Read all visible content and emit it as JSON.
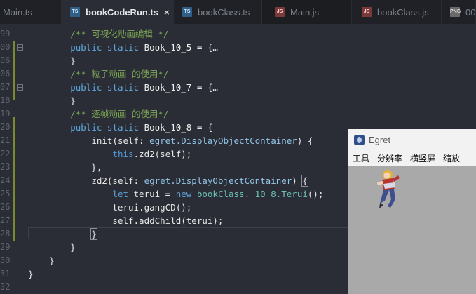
{
  "tabs": [
    {
      "label": "Main.ts",
      "icon": "ts-file-icon",
      "active": false
    },
    {
      "label": "bookCodeRun.ts",
      "icon": "ts-file-icon",
      "active": true,
      "close": "×"
    },
    {
      "label": "bookClass.ts",
      "icon": "ts-file-icon",
      "active": false
    },
    {
      "label": "Main.js",
      "icon": "js-file-icon",
      "active": false
    },
    {
      "label": "bookClass.js",
      "icon": "js-file-icon",
      "active": false
    },
    {
      "label": "00",
      "icon": "png-file-icon",
      "active": false
    }
  ],
  "editor": {
    "lines": [
      {
        "num": "99",
        "text": "        /** 可视化动画编辑 */"
      },
      {
        "num": "00",
        "text": "        public static Book_10_5 = {…"
      },
      {
        "num": "06",
        "text": "        }"
      },
      {
        "num": "06",
        "text": "        /** 粒子动画 的使用*/"
      },
      {
        "num": "07",
        "text": "        public static Book_10_7 = {…"
      },
      {
        "num": "18",
        "text": "        }"
      },
      {
        "num": "19",
        "text": "        /** 逐帧动画 的使用*/"
      },
      {
        "num": "20",
        "text": "        public static Book_10_8 = {"
      },
      {
        "num": "21",
        "text": "            init(self: egret.DisplayObjectContainer) {"
      },
      {
        "num": "22",
        "text": "                this.zd2(self);"
      },
      {
        "num": "23",
        "text": "            },"
      },
      {
        "num": "24",
        "text": "            zd2(self: egret.DisplayObjectContainer) {"
      },
      {
        "num": "25",
        "text": "                let terui = new bookClass._10_8.Terui();"
      },
      {
        "num": "26",
        "text": "                terui.gangCD();"
      },
      {
        "num": "27",
        "text": "                self.addChild(terui);"
      },
      {
        "num": "28",
        "text": "            }"
      },
      {
        "num": "29",
        "text": "        }"
      },
      {
        "num": "30",
        "text": "    }"
      },
      {
        "num": "31",
        "text": "}"
      },
      {
        "num": "32",
        "text": ""
      }
    ]
  },
  "egret_window": {
    "title": "Egret",
    "menu": [
      "工具",
      "分辨率",
      "横竖屏",
      "缩放"
    ]
  }
}
